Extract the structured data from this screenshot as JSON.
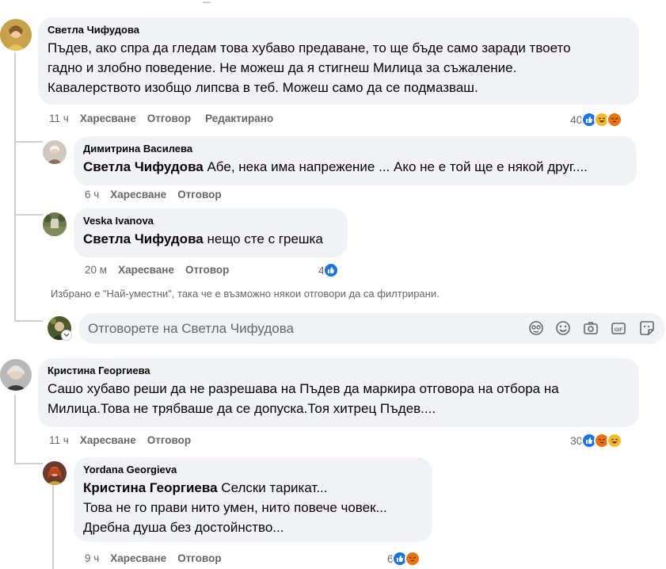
{
  "comments": [
    {
      "author": "Светла Чифудова",
      "lines": [
        "Пъдев, ако спра да гледам това хубаво предаване, то ще бъде само заради твоето",
        "гадно и злобно поведение. Не можеш да я стигнеш Милица за съжаление.",
        "Кавалерството изобщо липсва в теб. Можеш само да се подмазваш."
      ],
      "time": "11 ч",
      "like": "Харесване",
      "reply": "Отговор",
      "edited": "Редактирано",
      "reactions_count": "40",
      "reaction_icons": [
        "like-icon",
        "haha-icon",
        "angry-icon"
      ]
    },
    {
      "author": "Кристина Георгиева",
      "lines": [
        "Сашо хубаво реши да не разрешава на Пъдев да маркира отговора на отбора на",
        "Милица.Това не трябваше да се допуска.Тоя хитрец Пъдев...."
      ],
      "time": "11 ч",
      "like": "Харесване",
      "reply": "Отговор",
      "reactions_count": "30",
      "reaction_icons": [
        "like-icon",
        "angry-icon",
        "haha-icon"
      ]
    }
  ],
  "replies": [
    {
      "author": "Димитрина Василева",
      "mention": "Светла Чифудова",
      "text": " Абе, нека има напрежение ... Ако не е той ще е някой друг....",
      "time": "6 ч",
      "like": "Харесване",
      "reply": "Отговор"
    },
    {
      "author": "Veska Ivanova",
      "mention": "Светла Чифудова",
      "text": " нещо сте с грешка",
      "time": "20 м",
      "like": "Харесване",
      "reply": "Отговор",
      "reactions_count": "4"
    },
    {
      "author": "Yordana Georgieva",
      "mention": "Кристина Георгиева",
      "text": " Селски тарикат...",
      "lines": [
        "Това не го прави нито умен, нито повече човек...",
        "Дребна душа без достойнство..."
      ],
      "time": "9 ч",
      "like": "Харесване",
      "reply": "Отговор",
      "reactions_count": "6"
    }
  ],
  "filter_note": "Избрано е \"Най-уместни\", така че е възможно някои отговори да са филтрирани.",
  "reply_box": {
    "placeholder": "Отговорете на Светла Чифудова",
    "tools": [
      "avatar-sticker-icon",
      "emoji-icon",
      "camera-icon",
      "gif-icon",
      "sticker-icon"
    ]
  },
  "colors": {
    "bubble": "#f0f2f5",
    "meta": "#65676b",
    "like_blue": "#1b74e4",
    "haha_yellow": "#f7b928",
    "angry_orange": "#e9710f"
  }
}
